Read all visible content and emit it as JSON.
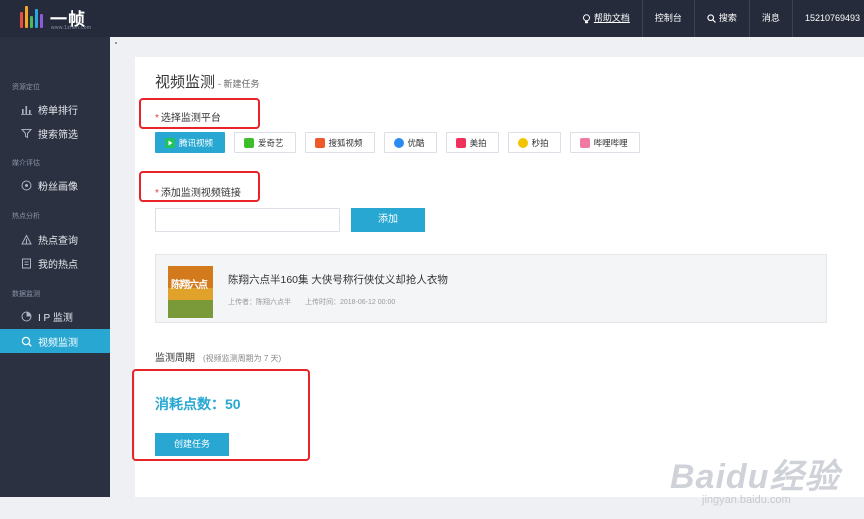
{
  "colors": {
    "topbar": "#252b3b",
    "sidebar": "#2b3140",
    "accent": "#27a7d2",
    "highlight": "#e8232a"
  },
  "logo": {
    "title": "一帧",
    "subtitle": "www.1zhen.com"
  },
  "topnav": {
    "help": "帮助文档",
    "console": "控制台",
    "search": "搜索",
    "messages": "消息",
    "phone": "15210769493"
  },
  "sidebar": {
    "sections": [
      {
        "label": "资源定位",
        "items": [
          {
            "label": "榜单排行",
            "icon": "bar-chart-icon"
          },
          {
            "label": "搜索筛选",
            "icon": "filter-icon"
          }
        ]
      },
      {
        "label": "媒介评估",
        "items": [
          {
            "label": "粉丝画像",
            "icon": "fan-portrait-icon"
          }
        ]
      },
      {
        "label": "热点分析",
        "items": [
          {
            "label": "热点查询",
            "icon": "hot-query-icon"
          },
          {
            "label": "我的热点",
            "icon": "my-hot-icon"
          }
        ]
      },
      {
        "label": "数据监测",
        "items": [
          {
            "label": "I P 监测",
            "icon": "ip-monitor-icon"
          },
          {
            "label": "视频监测",
            "icon": "video-monitor-icon",
            "active": true
          }
        ]
      }
    ]
  },
  "page": {
    "title": "视频监测",
    "subtitle": "- 新建任务",
    "platform_label": "选择监测平台",
    "platforms": [
      {
        "label": "腾讯视频",
        "icon": "tencent-video-icon",
        "color": "#21c35f",
        "selected": true
      },
      {
        "label": "爱奇艺",
        "icon": "iqiyi-icon",
        "color": "#3dbf2a"
      },
      {
        "label": "搜狐视频",
        "icon": "sohu-video-icon",
        "color": "#f05a28"
      },
      {
        "label": "优酷",
        "icon": "youku-icon",
        "color": "#2a8cf0"
      },
      {
        "label": "美拍",
        "icon": "meipai-icon",
        "color": "#f0325a"
      },
      {
        "label": "秒拍",
        "icon": "miaopai-icon",
        "color": "#f2c400"
      },
      {
        "label": "哔哩哔哩",
        "icon": "bilibili-icon",
        "color": "#f07aa0"
      }
    ],
    "link_label": "添加监测视频链接",
    "link_input_value": "",
    "add_button": "添加",
    "video": {
      "title": "陈翔六点半160集 大侠号称行侠仗义却抢人衣物",
      "uploader": "上传者：陈翔六点半",
      "upload_time": "上传时间：2018-06-12 00:00",
      "thumb_text": "陈翔六点"
    },
    "period_label": "监测周期",
    "period_hint": "(视频监测周期为 7 天)",
    "cost": "消耗点数：50",
    "create_button": "创建任务"
  },
  "watermark": {
    "brand": "Baidu经验",
    "url": "jingyan.baidu.com"
  }
}
